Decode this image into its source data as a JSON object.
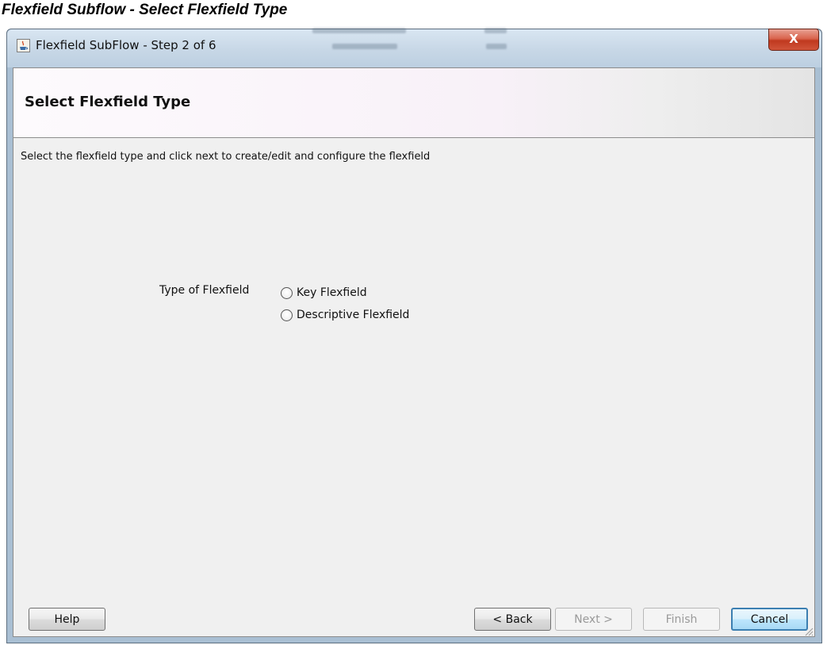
{
  "caption": "Flexfield Subflow - Select Flexfield Type",
  "window": {
    "title": "Flexfield SubFlow - Step 2 of 6",
    "close_label": "X"
  },
  "header": {
    "title": "Select Flexfield Type"
  },
  "instructions": "Select the flexfield type and click next to create/edit and configure the flexfield",
  "form": {
    "type_label": "Type of Flexfield",
    "options": [
      {
        "label": "Key Flexfield",
        "selected": false
      },
      {
        "label": "Descriptive Flexfield",
        "selected": false
      }
    ]
  },
  "buttons": {
    "help": {
      "label": "Help",
      "enabled": true
    },
    "back": {
      "label": "< Back",
      "enabled": true
    },
    "next": {
      "label": "Next >",
      "enabled": false
    },
    "finish": {
      "label": "Finish",
      "enabled": false
    },
    "cancel": {
      "label": "Cancel",
      "enabled": true
    }
  }
}
